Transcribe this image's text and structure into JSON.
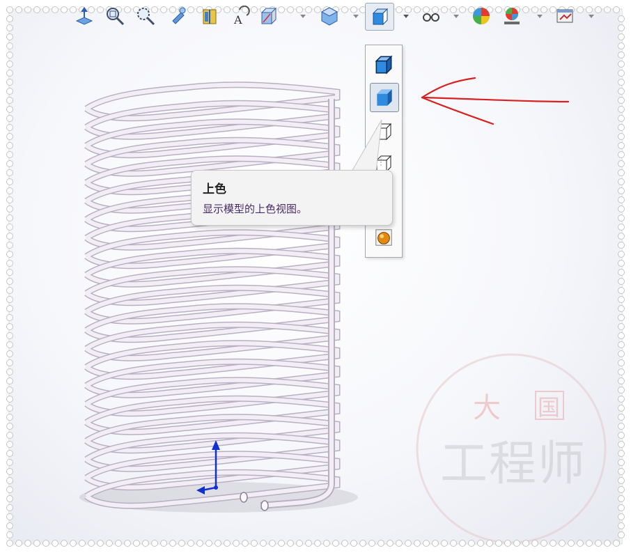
{
  "toolbar": {
    "items": [
      {
        "name": "view-orientation-icon"
      },
      {
        "name": "zoom-to-fit-icon"
      },
      {
        "name": "zoom-to-area-icon"
      },
      {
        "name": "previous-view-icon"
      },
      {
        "name": "section-view-icon"
      },
      {
        "name": "dynamic-annotation-icon"
      },
      {
        "name": "view-orientation-dropdown-icon"
      },
      {
        "name": "display-style-icon"
      },
      {
        "name": "hide-show-items-icon"
      },
      {
        "name": "edit-appearance-icon"
      },
      {
        "name": "apply-scene-icon"
      },
      {
        "name": "view-settings-icon"
      }
    ]
  },
  "flyout": {
    "items": [
      {
        "name": "shaded-with-edges-icon"
      },
      {
        "name": "shaded-icon",
        "selected": true
      },
      {
        "name": "hidden-lines-removed-icon"
      },
      {
        "name": "hidden-lines-visible-icon"
      },
      {
        "name": "wireframe-icon"
      },
      {
        "name": "render-icon"
      }
    ]
  },
  "tooltip": {
    "title": "上色",
    "description": "显示模型的上色视图。"
  },
  "watermark": {
    "seal_text": "大国",
    "text": "工程师"
  },
  "colors": {
    "annotation_arrow": "#d82020",
    "shaded_cube": "#2f8be0",
    "coil": "#f3eef6",
    "triad_axis": "#1030d0"
  }
}
